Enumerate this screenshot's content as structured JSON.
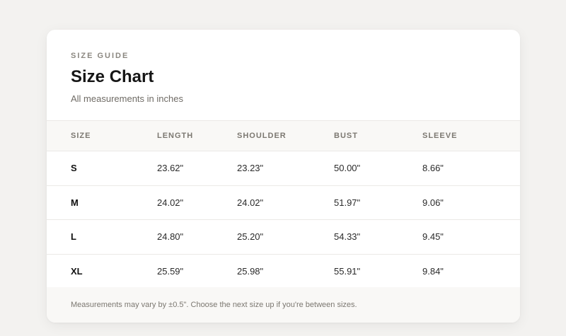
{
  "header": {
    "eyebrow": "SIZE GUIDE",
    "title": "Size Chart",
    "subtitle": "All measurements in inches"
  },
  "table": {
    "columns": [
      "SIZE",
      "LENGTH",
      "SHOULDER",
      "BUST",
      "SLEEVE"
    ],
    "rows": [
      [
        "S",
        "23.62\"",
        "23.23\"",
        "50.00\"",
        "8.66\""
      ],
      [
        "M",
        "24.02\"",
        "24.02\"",
        "51.97\"",
        "9.06\""
      ],
      [
        "L",
        "24.80\"",
        "25.20\"",
        "54.33\"",
        "9.45\""
      ],
      [
        "XL",
        "25.59\"",
        "25.98\"",
        "55.91\"",
        "9.84\""
      ]
    ]
  },
  "footer": {
    "note": "Measurements may vary by ±0.5\". Choose the next size up if you're between sizes."
  }
}
